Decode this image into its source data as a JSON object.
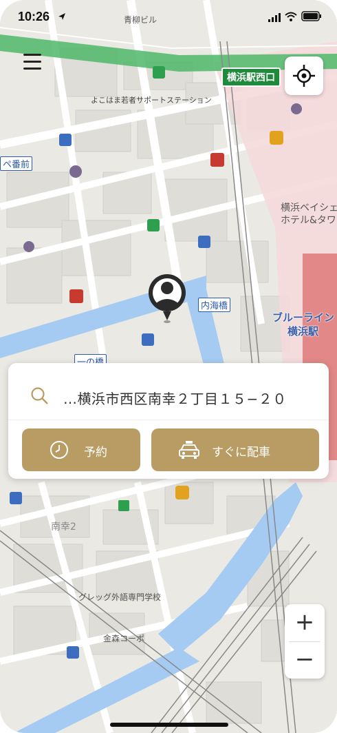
{
  "status_bar": {
    "time": "10:26"
  },
  "map": {
    "labels": {
      "aoyagi_bldg": "青柳ビル",
      "yokohama_youth_station": "よこはま若者サポートステーション",
      "bay_hotel_line1": "横浜ベイシェ",
      "bay_hotel_line2": "ホテル&タワ",
      "blue_line": "ブルーライン",
      "yokohama_eki": "横浜駅",
      "minamisaiwai": "南幸2",
      "gregg_school": "グレッグ外語専門学校",
      "kanamori_corpo": "金森コーポ",
      "station_west_exit": "横浜駅西口",
      "bus_front": "ペ番前",
      "bridge_uchiumi": "内海橋",
      "bridge_ichinohashi": "一の橋"
    }
  },
  "search": {
    "address": "…横浜市西区南幸２丁目１５−２０"
  },
  "buttons": {
    "reserve": "予約",
    "dispatch_now": "すぐに配車"
  },
  "zoom": {
    "plus": "+",
    "minus": "−"
  },
  "colors": {
    "accent": "#b99c63",
    "water": "#a5cbf2",
    "rail": "#4fb86a"
  }
}
